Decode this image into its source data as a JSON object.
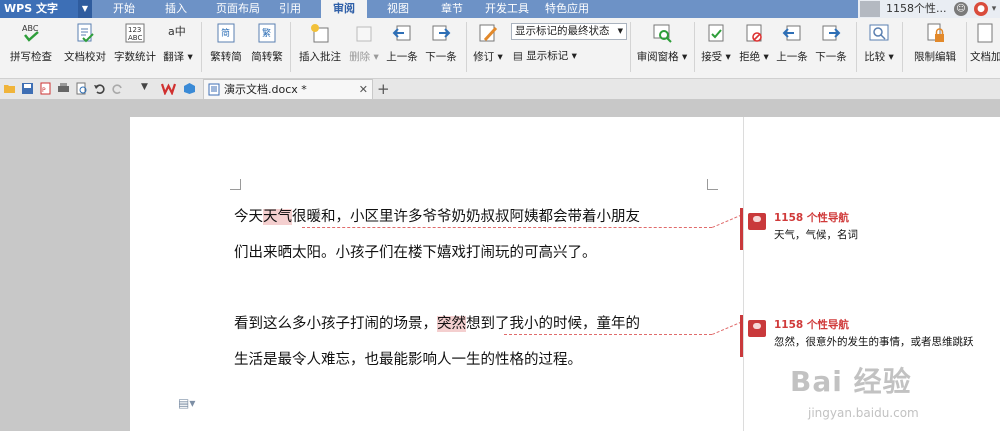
{
  "app": {
    "name": "WPS 文字"
  },
  "menu": {
    "tabs": [
      {
        "label": "开始"
      },
      {
        "label": "插入"
      },
      {
        "label": "页面布局"
      },
      {
        "label": "引用"
      },
      {
        "label": "审阅"
      },
      {
        "label": "视图"
      },
      {
        "label": "章节"
      },
      {
        "label": "开发工具"
      },
      {
        "label": "特色应用"
      }
    ],
    "active_tab": "审阅"
  },
  "user": {
    "name": "1158个性..."
  },
  "ribbon": {
    "spell_check": "拼写检查",
    "doc_proof": "文档校对",
    "word_count": "字数统计",
    "translate": "翻译",
    "trad_to_simp": "繁转简",
    "simp_to_trad": "简转繁",
    "insert_comment": "插入批注",
    "delete": "删除",
    "prev": "上一条",
    "next": "下一条",
    "track_changes": "修订",
    "markup_state": "显示标记的最终状态",
    "show_markup": "显示标记",
    "review_pane": "审阅窗格",
    "accept": "接受",
    "reject": "拒绝",
    "prev2": "上一条",
    "next2": "下一条",
    "compare": "比较",
    "restrict_edit": "限制编辑",
    "doc_right": "文档加",
    "icon_text_abc": "ABC",
    "icon_text_count": "123",
    "icon_text_trans": "a中",
    "icon_text_simp": "简",
    "icon_text_trad": "繁"
  },
  "doc_tab": {
    "name": "演示文档.docx *"
  },
  "document": {
    "para1": {
      "line1": {
        "before": "今天",
        "highlight": "天气",
        "after": "很暖和，小区里许多爷爷奶奶叔叔阿姨都会带着小朋友"
      },
      "line2": "们出来晒太阳。小孩子们在楼下嬉戏打闹玩的可高兴了。"
    },
    "para2": {
      "line1": {
        "before": "看到这么多小孩子打闹的场景，",
        "highlight": "突然",
        "after": "想到了我小的时候，童年的"
      },
      "line2": "生活是最令人难忘，也最能影响人一生的性格的过程。"
    }
  },
  "comments": [
    {
      "author": "1158 个性导航",
      "text": "天气，气候，名词"
    },
    {
      "author": "1158 个性导航",
      "text": "忽然，很意外的发生的事情，或者思维跳跃"
    }
  ],
  "watermark": {
    "brand": "Bai 经验",
    "url": "jingyan.baidu.com"
  },
  "colors": {
    "menubar": "#6d92c6",
    "app_button": "#3d6fb6",
    "comment_accent": "#c9393b",
    "highlight": "#f4cfcf"
  }
}
